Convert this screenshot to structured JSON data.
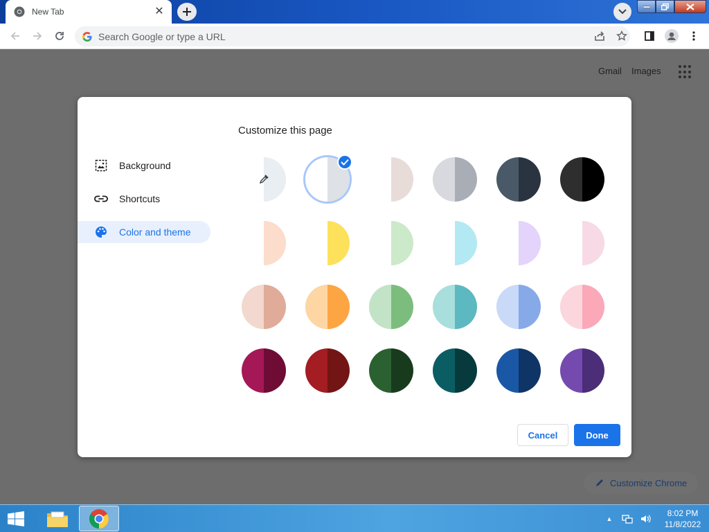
{
  "browser": {
    "tab": {
      "title": "New Tab",
      "close_glyph": "✕",
      "icon": "chrome-logo-icon"
    },
    "new_tab_glyph": "+",
    "omnibox": {
      "placeholder": "Search Google or type a URL",
      "icon": "google-g-icon"
    },
    "window_controls": {
      "minimize": "—",
      "maximize": "❐",
      "close": "✕"
    }
  },
  "ntp": {
    "links": {
      "gmail": "Gmail",
      "images": "Images"
    },
    "customize_chrome": "Customize Chrome"
  },
  "dialog": {
    "title": "Customize this page",
    "nav": [
      {
        "label": "Background",
        "icon": "image-icon",
        "active": false
      },
      {
        "label": "Shortcuts",
        "icon": "link-icon",
        "active": false
      },
      {
        "label": "Color and theme",
        "icon": "palette-icon",
        "active": true
      }
    ],
    "themes": [
      {
        "name": "custom-color",
        "left": "#ffffff",
        "right": "#e8eef2",
        "picker": true
      },
      {
        "name": "default",
        "left": "#ffffff",
        "right": "#dee1e6",
        "selected": true
      },
      {
        "name": "warm-grey",
        "left": "#ffffff",
        "right": "#e8dcd9"
      },
      {
        "name": "cool-grey",
        "left": "#d7d9de",
        "right": "#a8adb6"
      },
      {
        "name": "midnight-blue",
        "left": "#4a5968",
        "right": "#2a3440"
      },
      {
        "name": "black",
        "left": "#2e2e2e",
        "right": "#000000"
      },
      {
        "name": "beige-white",
        "left": "#ffffff",
        "right": "#fcdccb"
      },
      {
        "name": "yellow-white",
        "left": "#ffffff",
        "right": "#fde15b"
      },
      {
        "name": "green-white",
        "left": "#ffffff",
        "right": "#cce9c9"
      },
      {
        "name": "light-teal-white",
        "left": "#ffffff",
        "right": "#b3e9f3"
      },
      {
        "name": "light-purple-white",
        "left": "#ffffff",
        "right": "#e4d3fb"
      },
      {
        "name": "pink-white",
        "left": "#ffffff",
        "right": "#f8d9e6"
      },
      {
        "name": "beige",
        "left": "#f2d8ce",
        "right": "#e1ab99"
      },
      {
        "name": "orange",
        "left": "#fdd6a4",
        "right": "#fda543"
      },
      {
        "name": "light-green",
        "left": "#c3e3c7",
        "right": "#7cbd7e"
      },
      {
        "name": "light-teal",
        "left": "#a8dedc",
        "right": "#5cb8c1"
      },
      {
        "name": "light-blue",
        "left": "#c8daf7",
        "right": "#86a9e8"
      },
      {
        "name": "light-pink",
        "left": "#fcd6dd",
        "right": "#fba8b8"
      },
      {
        "name": "dark-pink-red",
        "left": "#a41857",
        "right": "#6e0c36"
      },
      {
        "name": "dark-red-orange",
        "left": "#a31d22",
        "right": "#731515"
      },
      {
        "name": "dark-green",
        "left": "#2b6031",
        "right": "#193b1d"
      },
      {
        "name": "dark-teal",
        "left": "#0a5e63",
        "right": "#073a3d"
      },
      {
        "name": "dark-blue",
        "left": "#1a58a6",
        "right": "#0f3566"
      },
      {
        "name": "purple",
        "left": "#744aaf",
        "right": "#4c2d78"
      }
    ],
    "buttons": {
      "cancel": "Cancel",
      "done": "Done"
    }
  },
  "taskbar": {
    "apps": [
      "windows-start-icon",
      "file-explorer-icon",
      "chrome-icon"
    ],
    "tray_arrow": "▲",
    "time": "8:02 PM",
    "date": "11/8/2022"
  },
  "colors": {
    "accent": "#1a73e8",
    "overlay": "#6d6d6d",
    "taskbar": "#3a8ed4"
  }
}
